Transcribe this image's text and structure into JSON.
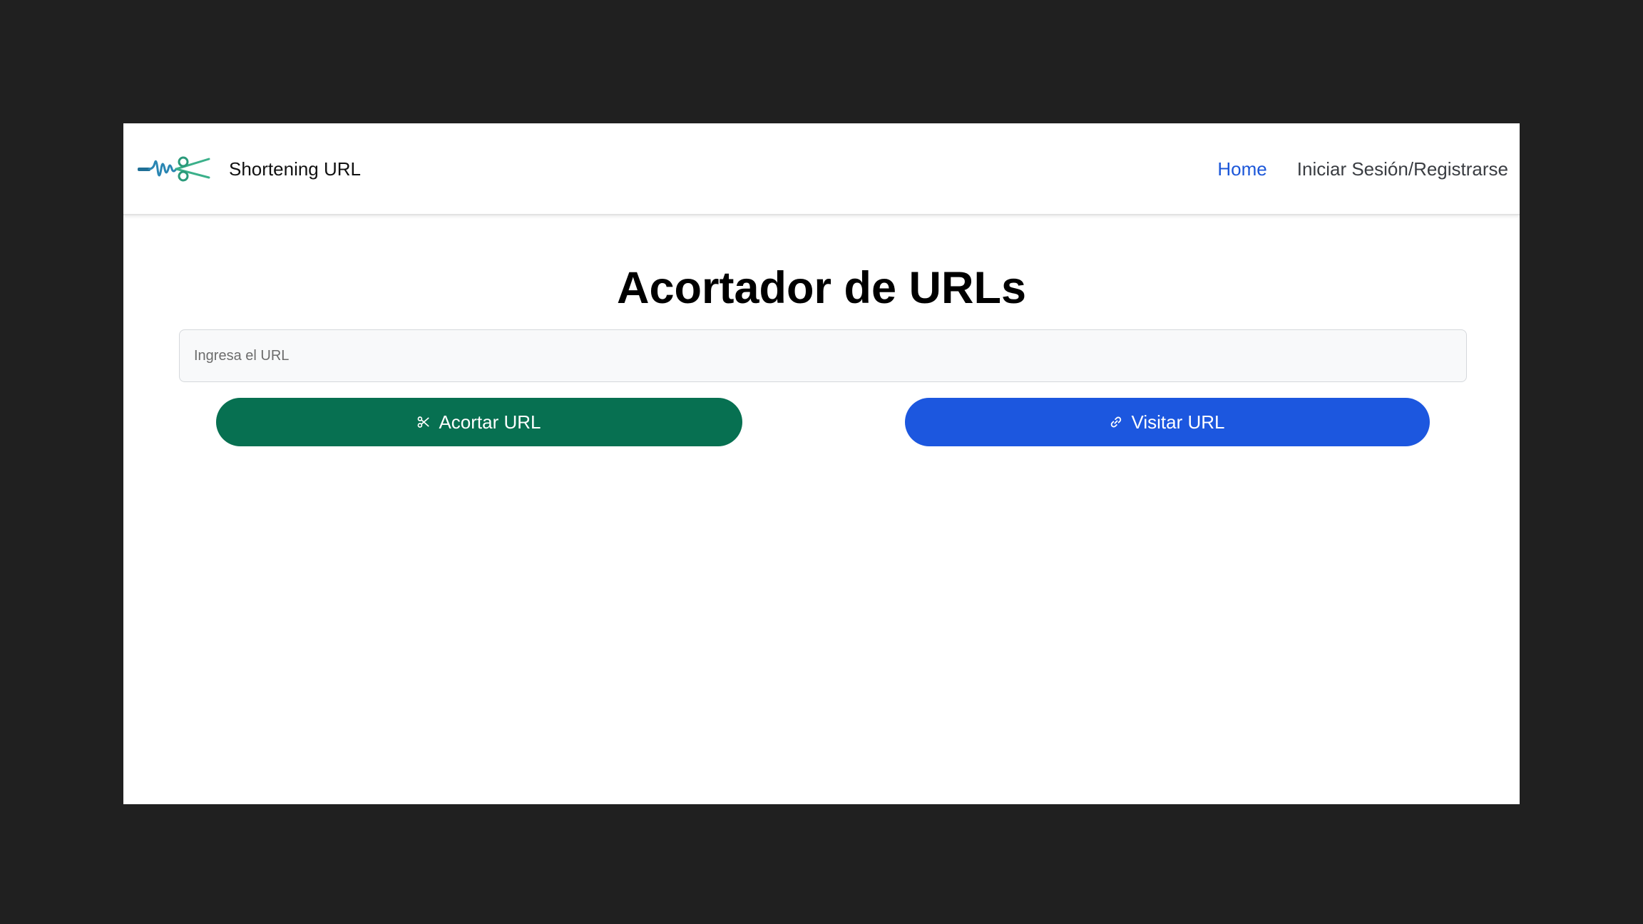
{
  "navbar": {
    "brand_name": "Shortening URL",
    "logo_icon": "scissors-waveform-logo-icon",
    "links": [
      {
        "label": "Home",
        "active": true
      },
      {
        "label": "Iniciar Sesión/Registrarse",
        "active": false
      }
    ]
  },
  "main": {
    "title": "Acortador de URLs",
    "url_input": {
      "placeholder": "Ingresa el URL",
      "value": ""
    },
    "shorten_button": {
      "label": "Acortar URL",
      "icon": "scissors-icon",
      "color": "#077051"
    },
    "visit_button": {
      "label": "Visitar URL",
      "icon": "link-icon",
      "color": "#1c57df"
    }
  },
  "colors": {
    "backdrop": "#202020",
    "page_background": "#ffffff",
    "nav_active": "#1c57d9",
    "nav_text": "#3a3d42"
  }
}
